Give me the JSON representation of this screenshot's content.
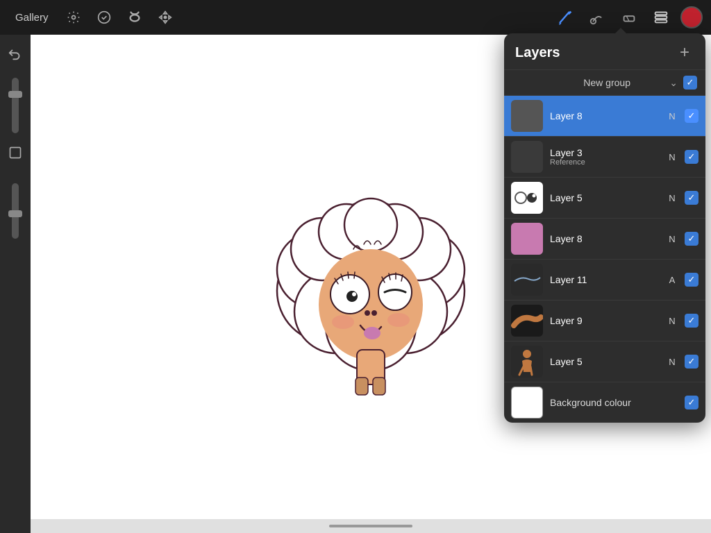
{
  "toolbar": {
    "gallery_label": "Gallery",
    "tools": [
      {
        "name": "modify-tool",
        "icon": "⚙",
        "active": false
      },
      {
        "name": "adjust-tool",
        "icon": "✦",
        "active": false
      },
      {
        "name": "smudge-tool",
        "icon": "S",
        "active": false
      },
      {
        "name": "move-tool",
        "icon": "✈",
        "active": false
      }
    ],
    "right_tools": [
      {
        "name": "brush-tool",
        "icon": "brush"
      },
      {
        "name": "smear-tool",
        "icon": "smear"
      },
      {
        "name": "eraser-tool",
        "icon": "eraser"
      },
      {
        "name": "layers-tool",
        "icon": "layers"
      }
    ],
    "color": "#c0222e"
  },
  "layers_panel": {
    "title": "Layers",
    "add_button": "+",
    "group_name": "New group",
    "layers": [
      {
        "id": "layer-8-active",
        "name": "Layer 8",
        "mode": "N",
        "active": true,
        "checked": true,
        "thumbnail_type": "dark"
      },
      {
        "id": "layer-3",
        "name": "Layer 3",
        "sublabel": "Reference",
        "mode": "N",
        "active": false,
        "checked": true,
        "thumbnail_type": "darker"
      },
      {
        "id": "layer-5-dots",
        "name": "Layer 5",
        "mode": "N",
        "active": false,
        "checked": true,
        "thumbnail_type": "dots"
      },
      {
        "id": "layer-8-pink",
        "name": "Layer 8",
        "mode": "N",
        "active": false,
        "checked": true,
        "thumbnail_type": "pink"
      },
      {
        "id": "layer-11",
        "name": "Layer 11",
        "mode": "A",
        "active": false,
        "checked": true,
        "thumbnail_type": "anim"
      },
      {
        "id": "layer-9",
        "name": "Layer 9",
        "mode": "N",
        "active": false,
        "checked": true,
        "thumbnail_type": "brown"
      },
      {
        "id": "layer-5-char",
        "name": "Layer 5",
        "mode": "N",
        "active": false,
        "checked": true,
        "thumbnail_type": "char"
      },
      {
        "id": "background-colour",
        "name": "Background colour",
        "mode": "",
        "active": false,
        "checked": true,
        "thumbnail_type": "white"
      }
    ]
  },
  "bottom_handle": "—"
}
